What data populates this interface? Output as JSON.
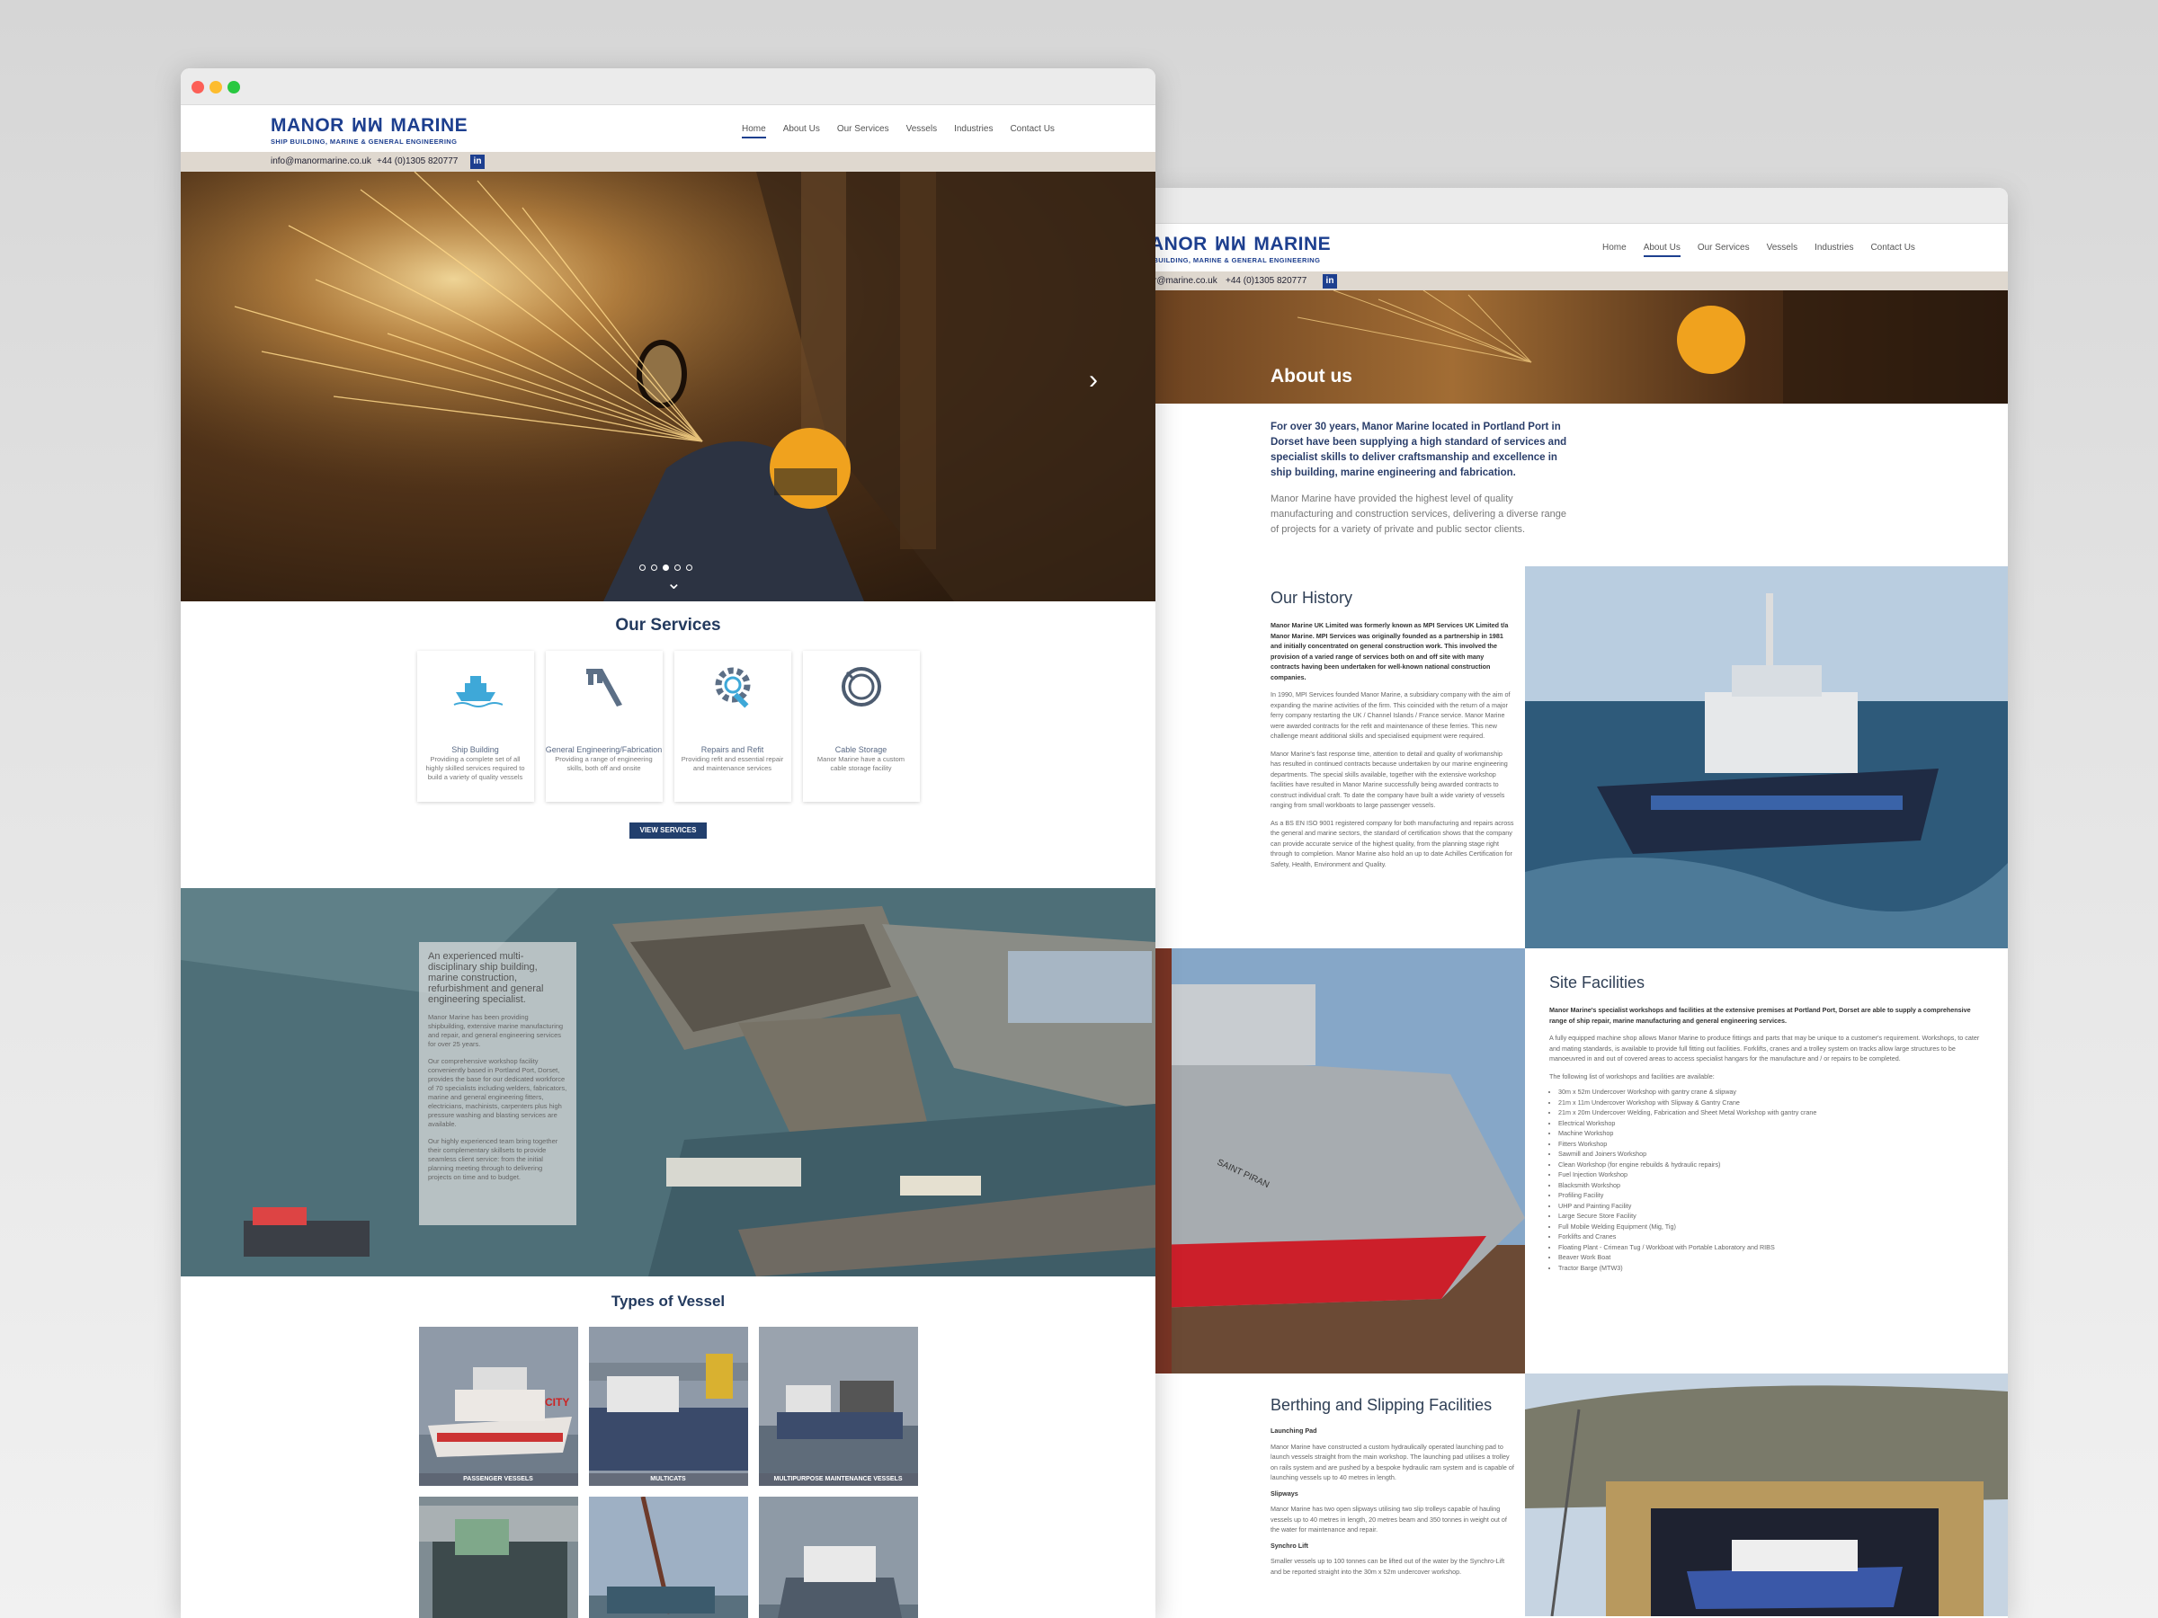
{
  "brand": {
    "name_left": "MANOR",
    "name_right": "MARINE",
    "tagline": "SHIP BUILDING, MARINE & GENERAL ENGINEERING",
    "email": "info@manormarine.co.uk",
    "email_short": "r@marine.co.uk",
    "phone": "+44 (0)1305 820777",
    "linkedin": "in",
    "colors": {
      "brand_blue": "#1d3f8f",
      "navy": "#223f6d"
    }
  },
  "nav": [
    "Home",
    "About Us",
    "Our Services",
    "Vessels",
    "Industries",
    "Contact Us"
  ],
  "home": {
    "services_title": "Our Services",
    "services": [
      {
        "title": "Ship Building",
        "desc": "Providing a complete set of all highly skilled services required to build a variety of quality vessels",
        "icon": "ship-icon"
      },
      {
        "title": "General Engineering/Fabrication",
        "desc": "Providing a range of engineering skills, both off and onsite",
        "icon": "caliper-icon"
      },
      {
        "title": "Repairs and Refit",
        "desc": "Providing refit and essential repair and maintenance services",
        "icon": "gear-wrench-icon"
      },
      {
        "title": "Cable Storage",
        "desc": "Manor Marine have a custom cable storage facility",
        "icon": "cable-coil-icon"
      }
    ],
    "services_button": "VIEW SERVICES",
    "aerial_lead": "An experienced multi-disciplinary ship building, marine construction, refurbishment and general engineering specialist.",
    "aerial_p1": "Manor Marine has been providing shipbuilding, extensive marine manufacturing and repair, and general engineering services for over 25 years.",
    "aerial_p2": "Our comprehensive workshop facility conveniently based in Portland Port, Dorset, provides the base for our dedicated workforce of 70 specialists including welders, fabricators, marine and general engineering fitters, electricians, machinists, carpenters plus high pressure washing and blasting services are available.",
    "aerial_p3": "Our highly experienced team bring together their complementary skillsets to provide seamless client service: from the initial planning meeting through to delivering projects on time and to budget.",
    "vessels_title": "Types of Vessel",
    "vessels": [
      "PASSENGER VESSELS",
      "MULTICATS",
      "MULTIPURPOSE MAINTENANCE VESSELS",
      "",
      "",
      ""
    ]
  },
  "about": {
    "title": "About us",
    "lead": "For over 30 years, Manor Marine located in Portland Port in Dorset have been supplying a high standard of services and specialist skills to deliver craftsmanship and excellence in ship building, marine engineering and fabrication.",
    "p1": "Manor Marine have provided the highest level of quality manufacturing and construction services, delivering a diverse range of projects for a variety of private and public sector clients.",
    "history_title": "Our History",
    "history_bold": "Manor Marine UK Limited was formerly known as MPI Services UK Limited t/a Manor Marine. MPI Services was originally founded as a partnership in 1981 and initially concentrated on general construction work. This involved the provision of a varied range of services both on and off site with many contracts having been undertaken for well-known national construction companies.",
    "history_p1": "In 1990, MPI Services founded Manor Marine, a subsidiary company with the aim of expanding the marine activities of the firm. This coincided with the return of a major ferry company restarting the UK / Channel Islands / France service. Manor Marine were awarded contracts for the refit and maintenance of these ferries. This new challenge meant additional skills and specialised equipment were required.",
    "history_p2": "Manor Marine's fast response time, attention to detail and quality of workmanship has resulted in continued contracts because undertaken by our marine engineering departments. The special skills available, together with the extensive workshop facilities have resulted in Manor Marine successfully being awarded contracts to construct individual craft. To date the company have built a wide variety of vessels ranging from small workboats to large passenger vessels.",
    "history_p3": "As a BS EN ISO 9001 registered company for both manufacturing and repairs across the general and marine sectors, the standard of certification shows that the company can provide accurate service of the highest quality, from the planning stage right through to completion. Manor Marine also hold an up to date Achilles Certification for Safety, Health, Environment and Quality.",
    "site_title": "Site Facilities",
    "site_bold": "Manor Marine's specialist workshops and facilities at the extensive premises at Portland Port, Dorset are able to supply a comprehensive range of ship repair, marine manufacturing and general engineering services.",
    "site_p1": "A fully equipped machine shop allows Manor Marine to produce fittings and parts that may be unique to a customer's requirement. Workshops, to cater and mating standards, is available to provide full fitting out facilities. Forklifts, cranes and a trolley system on tracks allow large structures to be manoeuvred in and out of covered areas to access specialist hangars for the manufacture and / or repairs to be completed.",
    "site_p2": "The following list of workshops and facilities are available:",
    "site_list": [
      "30m x 52m Undercover Workshop with gantry crane & slipway",
      "21m x 11m Undercover Workshop with Slipway & Gantry Crane",
      "21m x 20m Undercover Welding, Fabrication and Sheet Metal Workshop with gantry crane",
      "Electrical Workshop",
      "Machine Workshop",
      "Fitters Workshop",
      "Sawmill and Joiners Workshop",
      "Clean Workshop (for engine rebuilds & hydraulic repairs)",
      "Fuel Injection Workshop",
      "Blacksmith Workshop",
      "Profiling Facility",
      "UHP and Painting Facility",
      "Large Secure Store Facility",
      "Full Mobile Welding Equipment (Mig, Tig)",
      "Forklifts and Cranes",
      "Floating Plant - Crimean Tug / Workboat with Portable Laboratory and RIBS",
      "Beaver Work Boat",
      "Tractor Barge (MTW3)"
    ],
    "berth_title": "Berthing and Slipping Facilities",
    "berth_sub1": "Launching Pad",
    "berth_p1": "Manor Marine have constructed a custom hydraulically operated launching pad to launch vessels straight from the main workshop. The launching pad utilises a trolley on rails system and are pushed by a bespoke hydraulic ram system and is capable of launching vessels up to 40 metres in length.",
    "berth_sub2": "Slipways",
    "berth_p2": "Manor Marine has two open slipways utilising two slip trolleys capable of hauling vessels up to 40 metres in length, 20 metres beam and 350 tonnes in weight out of the water for maintenance and repair.",
    "berth_sub3": "Synchro Lift",
    "berth_p3": "Smaller vessels up to 100 tonnes can be lifted out of the water by the Synchro-Lift and be reported straight into the 30m x 52m undercover workshop."
  }
}
